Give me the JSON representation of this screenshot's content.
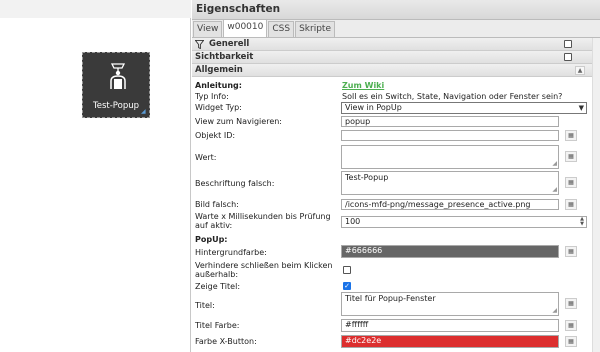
{
  "canvas": {
    "widget_label": "Test-Popup",
    "widget_bg": "#3a3a3a"
  },
  "panel": {
    "title": "Eigenschaften",
    "tabs": [
      "View",
      "w00010",
      "CSS",
      "Skripte"
    ],
    "active_tab": "w00010",
    "sections": {
      "generell": "Generell",
      "sichtbarkeit": "Sichtbarkeit",
      "allgemein": "Allgemein"
    },
    "fields": {
      "anleitung_label": "Anleitung:",
      "anleitung_link": "Zum Wiki",
      "typinfo_label": "Typ Info:",
      "typinfo_value": "Soll es ein Switch, State, Navigation oder Fenster sein?",
      "widgettyp_label": "Widget Typ:",
      "widgettyp_value": "View in PopUp",
      "view_label": "View zum Navigieren:",
      "view_value": "popup",
      "objektid_label": "Objekt ID:",
      "objektid_value": "",
      "wert_label": "Wert:",
      "wert_value": "",
      "beschriftung_label": "Beschriftung falsch:",
      "beschriftung_value": "Test-Popup",
      "bild_label": "Bild falsch:",
      "bild_value": "/icons-mfd-png/message_presence_active.png",
      "warte_label": "Warte x Millisekunden bis Prüfung auf aktiv:",
      "warte_value": "100",
      "popup_heading": "PopUp:",
      "hintergrund_label": "Hintergrundfarbe:",
      "hintergrund_value": "#666666",
      "hintergrund_color": "#666666",
      "verhindere_label": "Verhindere schließen beim Klicken außerhalb:",
      "verhindere_checked": false,
      "zeigetitel_label": "Zeige Titel:",
      "zeigetitel_checked": true,
      "titel_label": "Titel:",
      "titel_value": "Titel für Popup-Fenster",
      "titelfarbe_label": "Titel Farbe:",
      "titelfarbe_value": "#ffffff",
      "xbutton_label": "Farbe X-Button:",
      "xbutton_value": "#dc2e2e",
      "xbutton_color": "#dc2e2e"
    }
  }
}
